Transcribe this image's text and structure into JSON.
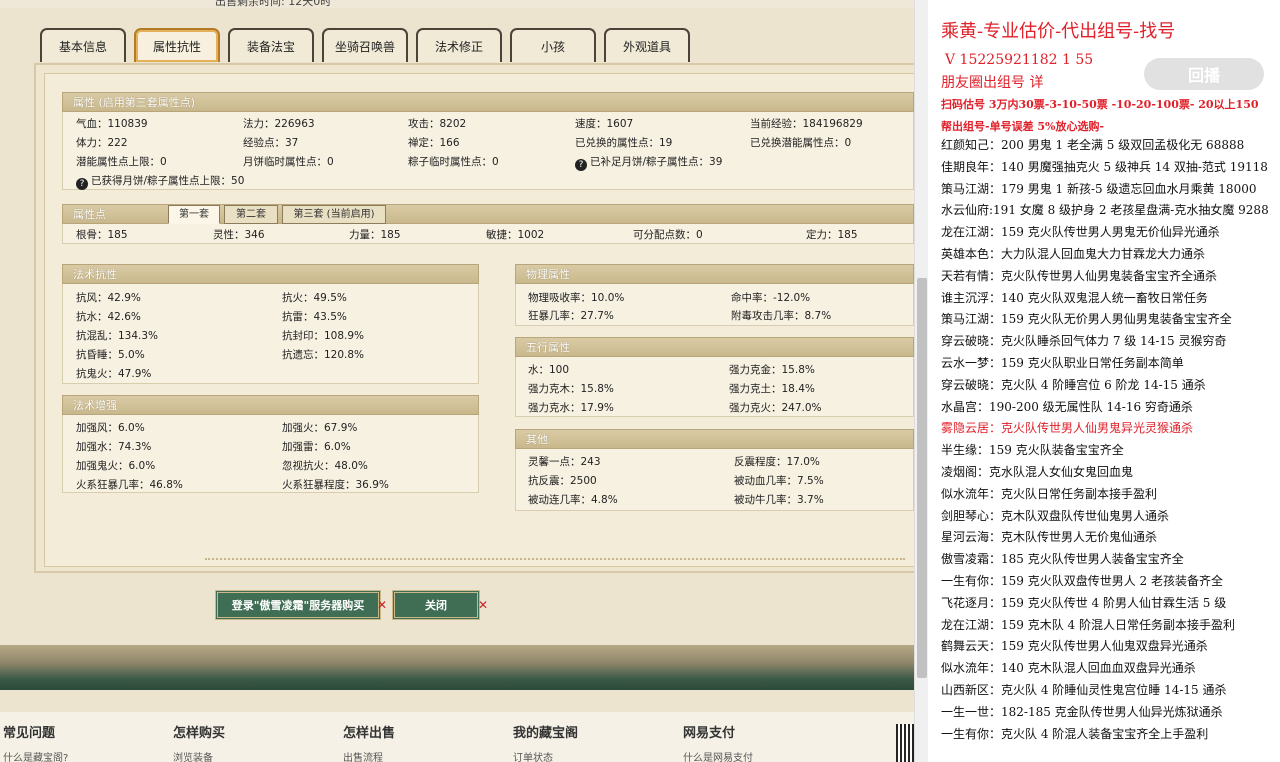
{
  "top": {
    "text": "出售剩余时间:   12天0时"
  },
  "tabs": [
    "基本信息",
    "属性抗性",
    "装备法宝",
    "坐骑召唤兽",
    "法术修正",
    "小孩",
    "外观道具"
  ],
  "active_tab": 1,
  "attrs": {
    "header": "属性 (启用第三套属性点)",
    "row1": [
      "气血：110839",
      "法力：226963",
      "攻击：8202",
      "速度：1607",
      "当前经验：184196829"
    ],
    "row2": [
      "体力：222",
      "经验点：37",
      "禅定：166",
      "已兑换的属性点：19",
      "已兑换潜能属性点：0"
    ],
    "row3": [
      "潜能属性点上限：0",
      "月饼临时属性点：0",
      "粽子临时属性点：0",
      "已补足月饼/粽子属性点：39"
    ],
    "row4": "已获得月饼/粽子属性点上限：50"
  },
  "points": {
    "header": "属性点",
    "subtabs": [
      "第一套",
      "第二套",
      "第三套 (当前启用)"
    ],
    "values": [
      "根骨：185",
      "灵性：346",
      "力量：185",
      "敏捷：1002",
      "可分配点数：0",
      "定力：185"
    ]
  },
  "resist": {
    "header": "法术抗性",
    "left": [
      "抗风：42.9%",
      "抗水：42.6%",
      "抗混乱：134.3%",
      "抗昏睡：5.0%",
      "抗鬼火：47.9%"
    ],
    "right": [
      "抗火：49.5%",
      "抗雷：43.5%",
      "抗封印：108.9%",
      "抗遗忘：120.8%"
    ]
  },
  "enhance": {
    "header": "法术增强",
    "left": [
      "加强风：6.0%",
      "加强水：74.3%",
      "加强鬼火：6.0%",
      "火系狂暴几率：46.8%"
    ],
    "right": [
      "加强火：67.9%",
      "加强雷：6.0%",
      "忽视抗火：48.0%",
      "火系狂暴程度：36.9%"
    ]
  },
  "physical": {
    "header": "物理属性",
    "left": [
      "物理吸收率：10.0%",
      "狂暴几率：27.7%"
    ],
    "right": [
      "命中率：-12.0%",
      "附毒攻击几率：8.7%"
    ]
  },
  "wuxing": {
    "header": "五行属性",
    "left": [
      "水：100",
      "强力克木：15.8%",
      "强力克水：17.9%"
    ],
    "right": [
      "强力克金：15.8%",
      "强力克土：18.4%",
      "强力克火：247.0%"
    ]
  },
  "other": {
    "header": "其他",
    "left": [
      "灵馨一点：243",
      "抗反震：2500",
      "被动连几率：4.8%"
    ],
    "right": [
      "反震程度：17.0%",
      "被动血几率：7.5%",
      "被动牛几率：3.7%"
    ]
  },
  "buttons": {
    "login": "登录\"傲雪凌霜\"服务器购买",
    "close": "关闭"
  },
  "footer": [
    {
      "title": "常见问题",
      "link": "什么是藏宝阁?"
    },
    {
      "title": "怎样购买",
      "link": "浏览装备"
    },
    {
      "title": "怎样出售",
      "link": "出售流程"
    },
    {
      "title": "我的藏宝阁",
      "link": "订单状态"
    },
    {
      "title": "网易支付",
      "link": "什么是网易支付"
    }
  ],
  "chat": {
    "title": "乘黄-专业估价-代出组号-找号",
    "phone": "V 15225921182    1       55",
    "sub": "朋友圈出组号     详",
    "logo": "回播",
    "scan": "扫码估号 3万内30票-3-10-50票 -10-20-100票- 20以上150",
    "help": "帮出组号-单号误差 5%放心选购-",
    "lines": [
      {
        "text": "红颜知己：200 男鬼 1 老全满 5 级双回孟极化无 68888",
        "red": false
      },
      {
        "text": "佳期良年：140 男魔强抽克火 5 级神兵 14 双抽-范式 19118",
        "red": false
      },
      {
        "text": "策马江湖：179 男鬼 1 新孩-5 级遗忘回血水月乘黄 18000",
        "red": false
      },
      {
        "text": "水云仙府:191 女魔 8 级护身 2 老孩星盘满-克水抽女魔 9288",
        "red": false
      },
      {
        "text": "龙在江湖：159 克火队传世男人男鬼无价仙异光通杀",
        "red": false
      },
      {
        "text": "英雄本色：大力队混人回血鬼大力甘霖龙大力通杀",
        "red": false
      },
      {
        "text": "天若有情：克火队传世男人仙男鬼装备宝宝齐全通杀",
        "red": false
      },
      {
        "text": "谁主沉浮：140 克火队双鬼混人统一畜牧日常任务",
        "red": false
      },
      {
        "text": "策马江湖：159 克火队无价男人男仙男鬼装备宝宝齐全",
        "red": false
      },
      {
        "text": "穿云破晓：克火队睡杀回气体力 7 级 14-15 灵猴穷奇",
        "red": false
      },
      {
        "text": "云水一梦：159 克火队职业日常任务副本简单",
        "red": false
      },
      {
        "text": "穿云破晓：克火队 4 阶睡宫位 6 阶龙 14-15 通杀",
        "red": false
      },
      {
        "text": "水晶宫：190-200 级无属性队 14-16 穷奇通杀",
        "red": false
      },
      {
        "text": "雾隐云居：克火队传世男人仙男鬼异光灵猴通杀",
        "red": true
      },
      {
        "text": "半生缘：159 克火队装备宝宝齐全",
        "red": false
      },
      {
        "text": "凌烟阁：克水队混人女仙女鬼回血鬼",
        "red": false
      },
      {
        "text": "似水流年：克火队日常任务副本接手盈利",
        "red": false
      },
      {
        "text": "剑胆琴心：克木队双盘队传世仙鬼男人通杀",
        "red": false
      },
      {
        "text": "星河云海：克木队传世男人无价鬼仙通杀",
        "red": false
      },
      {
        "text": "傲雪凌霜：185 克火队传世男人装备宝宝齐全",
        "red": false
      },
      {
        "text": "一生有你：159 克火队双盘传世男人 2 老孩装备齐全",
        "red": false
      },
      {
        "text": "飞花逐月：159 克火队传世 4 阶男人仙甘霖生活 5 级",
        "red": false
      },
      {
        "text": "龙在江湖：159 克木队 4 阶混人日常任务副本接手盈利",
        "red": false
      },
      {
        "text": "鹤舞云天：159 克火队传世男人仙鬼双盘异光通杀",
        "red": false
      },
      {
        "text": "似水流年：140 克木队混人回血血双盘异光通杀",
        "red": false
      },
      {
        "text": "山西新区：克火队 4 阶睡仙灵性鬼宫位睡 14-15 通杀",
        "red": false
      },
      {
        "text": "一生一世：182-185 克金队传世男人仙异光炼狱通杀",
        "red": false
      },
      {
        "text": "一生有你：克火队 4 阶混人装备宝宝齐全上手盈利",
        "red": false
      }
    ]
  }
}
